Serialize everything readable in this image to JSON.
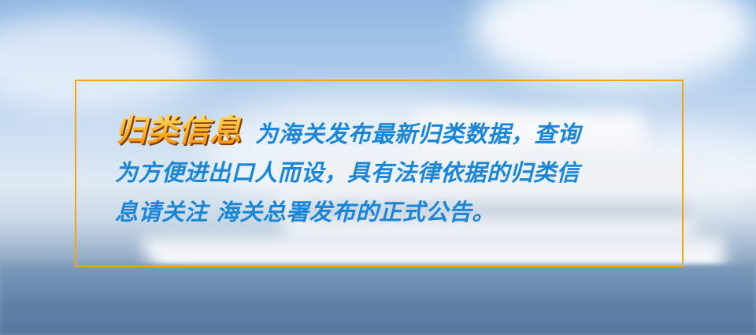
{
  "banner": {
    "title": "归类信息",
    "line1": "为海关发布最新归类数据，查询",
    "line2": "为方便进出口人而设，具有法律依据的归类信",
    "line3": "息请关注   海关总署发布的正式公告。"
  },
  "colors": {
    "frame": "#f2a51a",
    "body_text": "#1a86d8",
    "title_gradient_top": "#ffe37a",
    "title_gradient_bottom": "#f07d0a"
  }
}
